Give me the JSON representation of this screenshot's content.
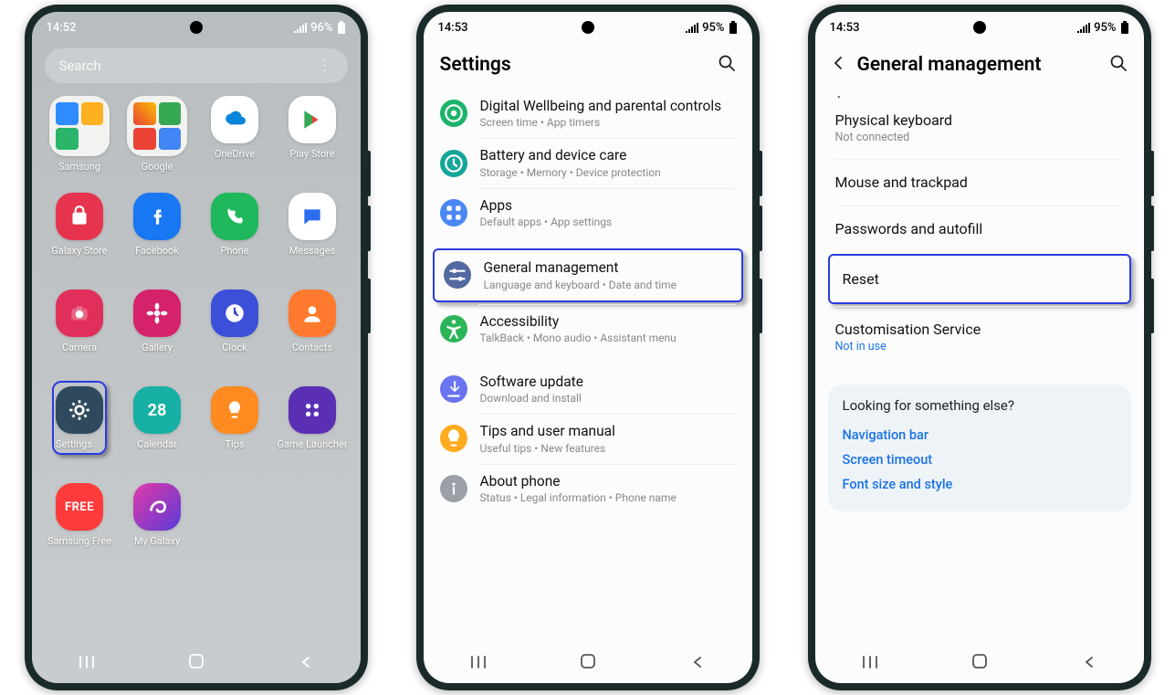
{
  "home": {
    "status": {
      "time": "14:52",
      "battery": "96%"
    },
    "search_placeholder": "Search",
    "apps": [
      {
        "label": "Samsung",
        "kind": "folder-samsung"
      },
      {
        "label": "Google",
        "kind": "folder-google"
      },
      {
        "label": "OneDrive",
        "bg": "#ffffff",
        "icon": "onedrive"
      },
      {
        "label": "Play Store",
        "bg": "#ffffff",
        "icon": "play"
      },
      {
        "label": "Galaxy Store",
        "bg": "#e6344e",
        "icon": "bag"
      },
      {
        "label": "Facebook",
        "bg": "#1877f2",
        "icon": "fb"
      },
      {
        "label": "Phone",
        "bg": "#1fb85c",
        "icon": "phone"
      },
      {
        "label": "Messages",
        "bg": "#ffffff",
        "icon": "message"
      },
      {
        "label": "Camera",
        "bg": "#e02f5a",
        "icon": "camera"
      },
      {
        "label": "Gallery",
        "bg": "#d6226a",
        "icon": "flower"
      },
      {
        "label": "Clock",
        "bg": "#3b4fd9",
        "icon": "clock"
      },
      {
        "label": "Contacts",
        "bg": "#ff7a2e",
        "icon": "contact"
      },
      {
        "label": "Settings",
        "bg": "#2f4a5e",
        "icon": "gear",
        "highlight": true
      },
      {
        "label": "Calendar",
        "bg": "#16b0a5",
        "icon": "cal",
        "badge": "28"
      },
      {
        "label": "Tips",
        "bg": "#ff8a1f",
        "icon": "bulb"
      },
      {
        "label": "Game Launcher",
        "bg": "#5b2fb3",
        "icon": "dots4"
      },
      {
        "label": "Samsung Free",
        "bg": "#ff3a3a",
        "icon": "free",
        "badge_text": "FREE"
      },
      {
        "label": "My Galaxy",
        "bg_grad": [
          "#e23aa8",
          "#5b3ad9"
        ],
        "icon": "swirl"
      }
    ]
  },
  "settings": {
    "status": {
      "time": "14:53",
      "battery": "95%"
    },
    "title": "Settings",
    "items": [
      {
        "icon_bg": "#1db36a",
        "icon": "wellbeing",
        "title": "Digital Wellbeing and parental controls",
        "sub": "Screen time  •  App timers"
      },
      {
        "icon_bg": "#15a598",
        "icon": "battery",
        "title": "Battery and device care",
        "sub": "Storage  •  Memory  •  Device protection"
      },
      {
        "icon_bg": "#4a87f5",
        "icon": "apps",
        "title": "Apps",
        "sub": "Default apps  •  App settings"
      },
      {
        "icon_bg": "#5469a0",
        "icon": "sliders",
        "title": "General management",
        "sub": "Language and keyboard  •  Date and time",
        "highlight": true,
        "section_gap": true
      },
      {
        "icon_bg": "#2cb558",
        "icon": "a11y",
        "title": "Accessibility",
        "sub": "TalkBack  •  Mono audio  •  Assistant menu"
      },
      {
        "icon_bg": "#6a73f0",
        "icon": "update",
        "title": "Software update",
        "sub": "Download and install",
        "section_gap": true
      },
      {
        "icon_bg": "#ffaa1f",
        "icon": "bulb",
        "title": "Tips and user manual",
        "sub": "Useful tips  •  New features"
      },
      {
        "icon_bg": "#9aa0a6",
        "icon": "info",
        "title": "About phone",
        "sub": "Status  •  Legal information  •  Phone name"
      }
    ]
  },
  "gm": {
    "status": {
      "time": "14:53",
      "battery": "95%"
    },
    "title": "General management",
    "items": [
      {
        "title": "Physical keyboard",
        "sub": "Not connected"
      },
      {
        "title": "Mouse and trackpad"
      },
      {
        "title": "Passwords and autofill"
      },
      {
        "title": "Reset",
        "highlight": true
      },
      {
        "title": "Customisation Service",
        "sub": "Not in use",
        "sub_blue": true
      }
    ],
    "suggest": {
      "title": "Looking for something else?",
      "links": [
        "Navigation bar",
        "Screen timeout",
        "Font size and style"
      ]
    }
  }
}
